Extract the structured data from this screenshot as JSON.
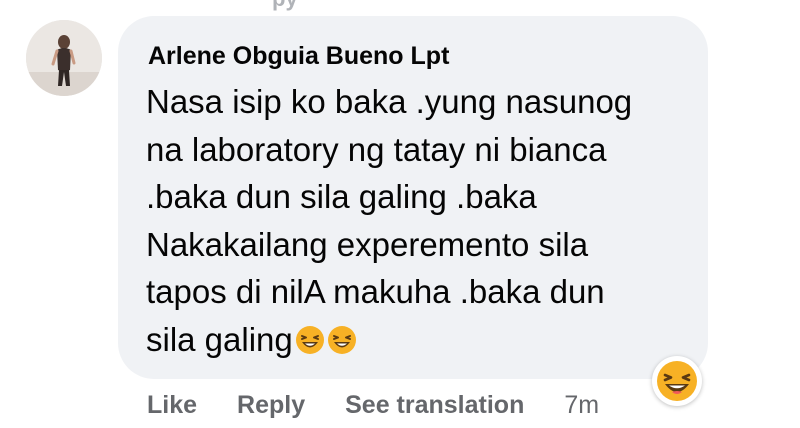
{
  "previous_row": {
    "reply_fragment": "py"
  },
  "comment": {
    "author": "Arlene Obguia Bueno Lpt",
    "text": "Nasa isip ko baka .yung nasunog\nna laboratory ng tatay ni bianca\n.baka dun sila galing .baka\nNakakailang experemento sila\ntapos di nilA makuha .baka dun\nsila galing",
    "inline_emojis": [
      "laughing-emoji",
      "laughing-emoji"
    ],
    "reaction": "haha"
  },
  "actions": {
    "like_label": "Like",
    "reply_label": "Reply",
    "translate_label": "See translation",
    "timestamp": "7m"
  },
  "colors": {
    "bubble_bg": "#f0f2f5",
    "action_text": "#65676b",
    "emoji_yellow": "#f7b125"
  }
}
